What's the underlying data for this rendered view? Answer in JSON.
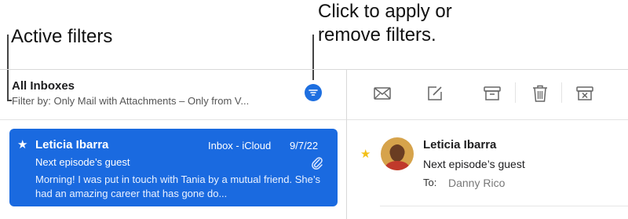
{
  "callouts": {
    "active_filters": "Active filters",
    "click_to_apply": "Click to apply or\nremove filters."
  },
  "message_list": {
    "title": "All Inboxes",
    "filter_status": "Filter by: Only Mail with Attachments – Only from V...",
    "filter_button_color": "#1e6fe0"
  },
  "toolbar": {
    "icons": [
      "envelope-icon",
      "compose-icon",
      "archive-icon",
      "trash-icon",
      "junk-icon"
    ]
  },
  "selected_message": {
    "flagged": "★",
    "sender": "Leticia Ibarra",
    "mailbox": "Inbox - iCloud",
    "date": "9/7/22",
    "subject": "Next episode’s guest",
    "preview": "Morning! I was put in touch with Tania by a mutual friend. She’s had an amazing career that has gone do...",
    "highlight_color": "#1a6ae0"
  },
  "message_detail": {
    "flagged": "★",
    "sender": "Leticia Ibarra",
    "subject": "Next episode’s guest",
    "to_label": "To:",
    "to_value": "Danny Rico",
    "star_color": "#f3c017"
  }
}
